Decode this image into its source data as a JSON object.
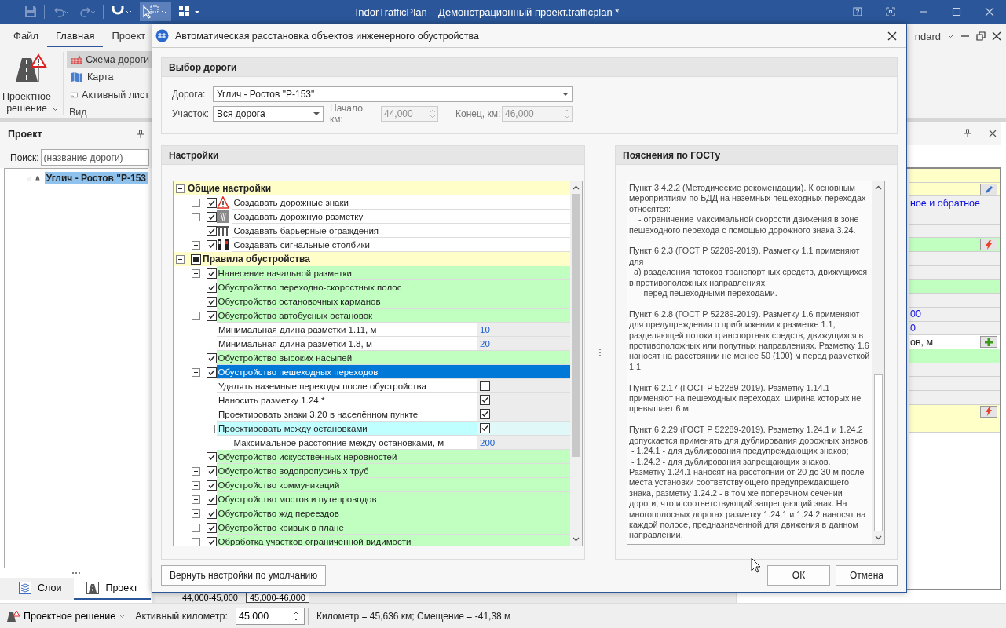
{
  "app": {
    "title": "IndorTrafficPlan – Демонстрационный проект.trafficplan *"
  },
  "ribbon": {
    "tabs": [
      {
        "label": "Файл",
        "selected": false
      },
      {
        "label": "Главная",
        "selected": true
      },
      {
        "label": "Проект",
        "selected": false
      }
    ],
    "layout_menu": "ndard",
    "big_button": "Проектное решение",
    "view_buttons": [
      {
        "label": "Схема дороги",
        "selected": true
      },
      {
        "label": "Карта",
        "selected": false
      },
      {
        "label": "Активный лист",
        "selected": false
      }
    ],
    "group_label": "Вид"
  },
  "project_panel": {
    "title": "Проект",
    "search": {
      "label": "Поиск:",
      "placeholder": "(название дороги)"
    },
    "items": [
      {
        "label": "Углич - Ростов \"Р-153",
        "checked": true,
        "selected": true
      }
    ],
    "tabs": [
      {
        "label": "Слои",
        "selected": false
      },
      {
        "label": "Проект",
        "selected": true
      }
    ]
  },
  "km_tabs": [
    {
      "label": "44,000-45,000",
      "selected": false
    },
    {
      "label": "45,000-46,000",
      "selected": true
    }
  ],
  "properties_panel": {
    "rows": [
      {
        "color": "#ffffc8"
      },
      {
        "color": "#ffffc8",
        "button": {
          "kind": "edit"
        }
      },
      {
        "color": "#f0f0f0",
        "kind": "value",
        "text": "ное и обратное"
      },
      {
        "color": "#f0f0f0"
      },
      {
        "color": "#f0f0f0"
      },
      {
        "color": "#c0ffc0",
        "button": {
          "kind": "run"
        }
      },
      {
        "color": "#f0f0f0"
      },
      {
        "color": "#f0f0f0"
      },
      {
        "color": "#c0ffc0"
      },
      {
        "color": "#f0f0f0"
      },
      {
        "color": "#f0f0f0",
        "kind": "value",
        "text": "00"
      },
      {
        "color": "#f0f0f0",
        "kind": "value",
        "text": "0"
      },
      {
        "color": "#ffffff",
        "kind": "label",
        "text": "ов, м",
        "button": {
          "kind": "add"
        }
      },
      {
        "color": "#c0ffc0"
      },
      {
        "color": "#f0f0f0"
      },
      {
        "color": "#f0f0f0"
      },
      {
        "color": "#f0f0f0"
      },
      {
        "color": "#ffffc8",
        "button": {
          "kind": "run"
        }
      },
      {
        "color": "#ffffc8"
      }
    ]
  },
  "status_bar": {
    "solution": "Проектное решение",
    "km_label": "Активный километр:",
    "km_value": "45,000",
    "position": "Километр = 45,636 км; Смещение = -41,38 м"
  },
  "dialog": {
    "title": "Автоматическая расстановка объектов инженерного обустройства",
    "road_group": {
      "title": "Выбор дороги",
      "road_label": "Дорога:",
      "road": "Углич - Ростов \"Р-153\"",
      "section_label": "Участок:",
      "section": "Вся дорога",
      "start_label": "Начало, км:",
      "start": "44,000",
      "end_label": "Конец, км:",
      "end": "46,000",
      "range_disabled": true
    },
    "settings": {
      "title": "Настройки",
      "tree": [
        {
          "kind": "section",
          "label": "Общие настройки",
          "expanded": true,
          "selected": false,
          "children": [
            {
              "kind": "option",
              "label": "Создавать дорожные знаки",
              "checked": true,
              "expanded": false,
              "selected": false
            },
            {
              "kind": "option",
              "label": "Создавать дорожную разметку",
              "checked": true,
              "expanded": false,
              "selected": false
            },
            {
              "kind": "option",
              "label": "Создавать барьерные ограждения",
              "checked": true,
              "selected": false
            },
            {
              "kind": "option",
              "label": "Создавать сигнальные столбики",
              "checked": true,
              "expanded": false,
              "selected": false
            }
          ]
        },
        {
          "kind": "section",
          "label": "Правила обустройства",
          "partial": true,
          "expanded": true,
          "selected": false,
          "children": [
            {
              "kind": "rule",
              "label": "Нанесение начальной разметки",
              "checked": true,
              "expanded": false,
              "selected": false
            },
            {
              "kind": "rule",
              "label": "Обустройство переходно-скоростных полос",
              "checked": true,
              "selected": false
            },
            {
              "kind": "rule",
              "label": "Обустройство остановочных карманов",
              "checked": true,
              "selected": false
            },
            {
              "kind": "rule",
              "label": "Обустройство автобусных остановок",
              "checked": true,
              "expanded": true,
              "selected": false,
              "children": [
                {
                  "kind": "param",
                  "label": "Минимальная длина разметки 1.11, м",
                  "value": "10",
                  "selected": false
                },
                {
                  "kind": "param",
                  "label": "Минимальная длина разметки 1.8, м",
                  "value": "20",
                  "selected": false
                }
              ]
            },
            {
              "kind": "rule",
              "label": "Обустройство высоких насыпей",
              "checked": true,
              "selected": false
            },
            {
              "kind": "rule",
              "label": "Обустройство пешеходных переходов",
              "checked": true,
              "expanded": true,
              "selected": true,
              "children": [
                {
                  "kind": "flag",
                  "label": "Удалять наземные переходы после обустройства",
                  "checked": false,
                  "selected": false
                },
                {
                  "kind": "flag",
                  "label": "Наносить разметку 1.24.*",
                  "checked": true,
                  "selected": false
                },
                {
                  "kind": "flag",
                  "label": "Проектировать знаки 3.20 в населённом пункте",
                  "checked": true,
                  "selected": false
                },
                {
                  "kind": "subgroup",
                  "label": "Проектировать между остановками",
                  "checked": true,
                  "expanded": true,
                  "selected": false,
                  "children": [
                    {
                      "kind": "param",
                      "label": "Максимальное расстояние между остановками, м",
                      "value": "200",
                      "selected": false
                    }
                  ]
                }
              ]
            },
            {
              "kind": "rule",
              "label": "Обустройство искусственных неровностей",
              "checked": true,
              "selected": false
            },
            {
              "kind": "rule",
              "label": "Обустройство водопропускных труб",
              "checked": true,
              "expanded": false,
              "selected": false
            },
            {
              "kind": "rule",
              "label": "Обустройство коммуникаций",
              "checked": true,
              "expanded": false,
              "selected": false
            },
            {
              "kind": "rule",
              "label": "Обустройство мостов и путепроводов",
              "checked": true,
              "expanded": false,
              "selected": false
            },
            {
              "kind": "rule",
              "label": "Обустройство ж/д переездов",
              "checked": true,
              "expanded": false,
              "selected": false
            },
            {
              "kind": "rule",
              "label": "Обустройство кривых в плане",
              "checked": true,
              "expanded": false,
              "selected": false
            },
            {
              "kind": "rule",
              "label": "Обработка участков ограниченной видимости",
              "checked": true,
              "expanded": false,
              "selected": false
            }
          ]
        }
      ]
    },
    "gost": {
      "title": "Пояснения по ГОСТу",
      "paragraphs": [
        "Пункт 3.4.2.2 (Методические рекомендации). К основным мероприятиям по БДД на наземных пешеходных переходах относятся:\n    - ограничение максимальной скорости движения в зоне пешеходного перехода с помощью дорожного знака 3.24.",
        "Пункт 6.2.3 (ГОСТ Р 52289-2019). Разметку 1.1 применяют для\n  а) разделения потоков транспортных средств, движущихся в противоположных направлениях:\n    - перед пешеходными переходами.",
        "Пункт 6.2.8 (ГОСТ Р 52289-2019). Разметку 1.6 применяют для предупреждения о приближении к разметке 1.1, разделяющей потоки транспортных средств, движущихся в противоположных или попутных направлениях. Разметку 1.6 наносят на расстоянии не менее 50 (100) м перед разметкой 1.1.",
        "Пункт 6.2.17 (ГОСТ Р 52289-2019). Разметку 1.14.1 применяют на пешеходных переходах, ширина которых не превышает 6 м.",
        "Пункт 6.2.29 (ГОСТ Р 52289-2019). Разметку 1.24.1 и 1.24.2 допускается применять для дублирования дорожных знаков:\n - 1.24.1 - для дублирования предупреждающих знаков;\n - 1.24.2 - для дублирования запрещающих знаков.\nРазметку 1.24.1 наносят на расстоянии от 20 до 30 м после места установки соответствующего предупреждающего знака, разметку 1.24.2 - в том же поперечном сечении дороги, что и соответствующий запрещающий знак. На многополосных дорогах разметку 1.24.1 и 1.24.2 наносят на каждой полосе, предназначенной для движения в данном направлении."
      ]
    },
    "buttons": {
      "reset": "Вернуть настройки по умолчанию",
      "ok": "ОК",
      "cancel": "Отмена"
    }
  }
}
